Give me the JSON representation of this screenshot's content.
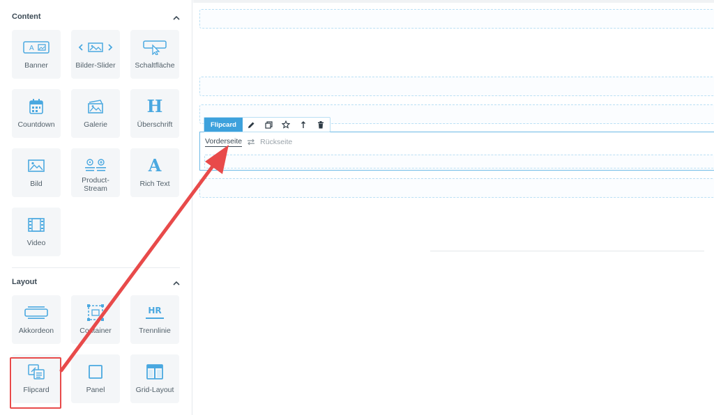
{
  "colors": {
    "accent": "#3da1dc",
    "icon": "#4aa8e0",
    "highlight": "#e84a4a"
  },
  "sidebar": {
    "sections": [
      {
        "title": "Content",
        "items": [
          {
            "label": "Banner",
            "icon": "banner-icon"
          },
          {
            "label": "Bilder-Slider",
            "icon": "image-slider-icon"
          },
          {
            "label": "Schaltfläche",
            "icon": "button-cursor-icon"
          },
          {
            "label": "Countdown",
            "icon": "calendar-icon"
          },
          {
            "label": "Galerie",
            "icon": "gallery-icon"
          },
          {
            "label": "Überschrift",
            "icon": "heading-icon"
          },
          {
            "label": "Bild",
            "icon": "image-icon"
          },
          {
            "label": "Product-\nStream",
            "icon": "product-stream-icon"
          },
          {
            "label": "Rich Text",
            "icon": "rich-text-icon"
          },
          {
            "label": "Video",
            "icon": "film-icon"
          }
        ]
      },
      {
        "title": "Layout",
        "items": [
          {
            "label": "Akkordeon",
            "icon": "accordion-icon"
          },
          {
            "label": "Container",
            "icon": "container-icon"
          },
          {
            "label": "Trennlinie",
            "icon": "divider-hr-icon"
          },
          {
            "label": "Flipcard",
            "icon": "flipcard-icon"
          },
          {
            "label": "Panel",
            "icon": "panel-icon"
          },
          {
            "label": "Grid-Layout",
            "icon": "grid-layout-icon"
          }
        ]
      }
    ]
  },
  "canvas": {
    "flipcard": {
      "tag": "Flipcard",
      "toolbar_icons": [
        "pencil-icon",
        "duplicate-icon",
        "star-icon",
        "move-up-icon",
        "trash-icon"
      ],
      "front_tab": "Vorderseite",
      "back_tab": "Rückseite"
    }
  },
  "icon_glyphs": {
    "heading": "H",
    "rich_text": "A",
    "hr": "HR"
  }
}
